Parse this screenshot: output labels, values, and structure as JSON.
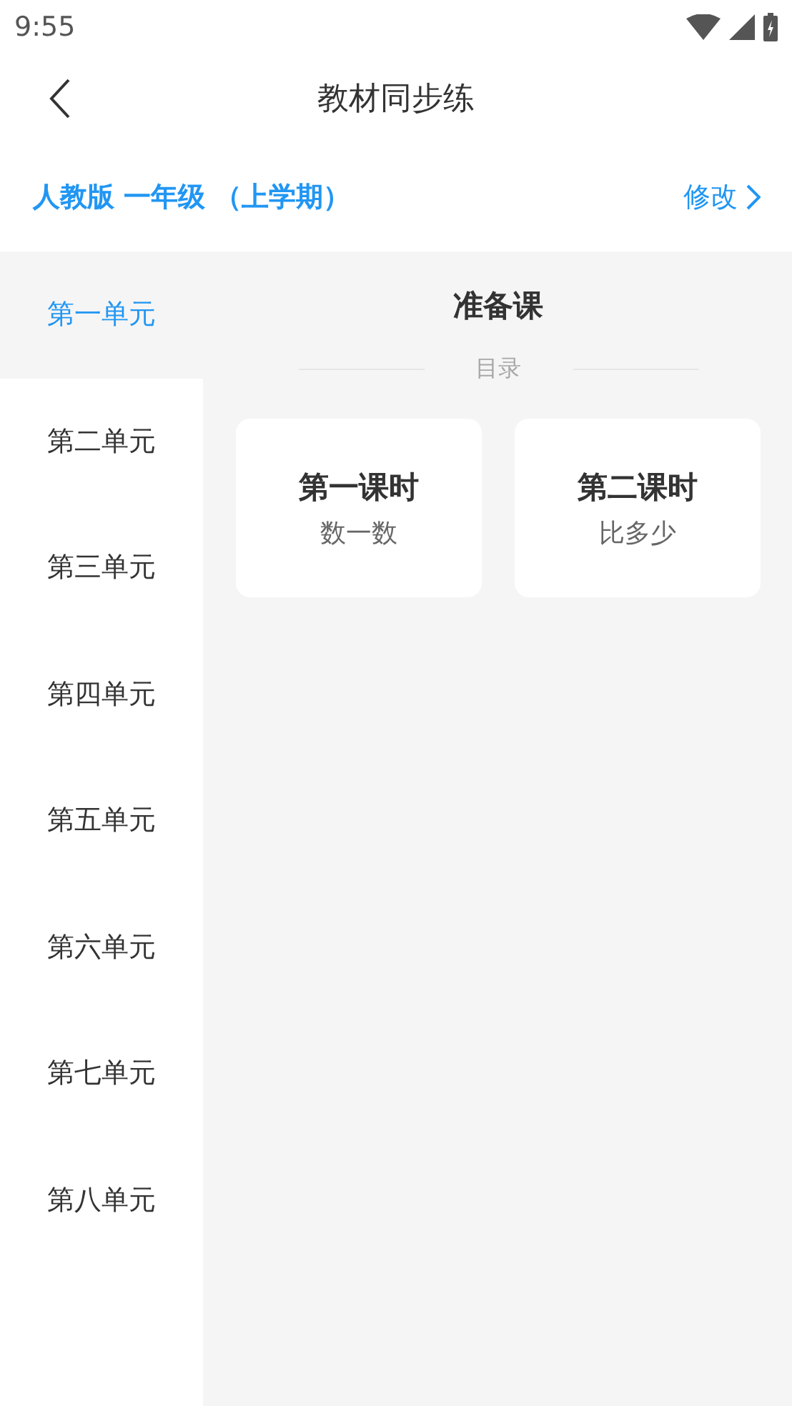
{
  "status_bar": {
    "time": "9:55"
  },
  "header": {
    "title": "教材同步练"
  },
  "textbook": {
    "name": "人教版 一年级 （上学期）",
    "change": "修改"
  },
  "units": [
    {
      "label": "第一单元",
      "selected": true
    },
    {
      "label": "第二单元",
      "selected": false
    },
    {
      "label": "第三单元",
      "selected": false
    },
    {
      "label": "第四单元",
      "selected": false
    },
    {
      "label": "第五单元",
      "selected": false
    },
    {
      "label": "第六单元",
      "selected": false
    },
    {
      "label": "第七单元",
      "selected": false
    },
    {
      "label": "第八单元",
      "selected": false
    }
  ],
  "section": {
    "title": "准备课",
    "divider": "目录",
    "lessons": [
      {
        "title": "第一课时",
        "subtitle": "数一数"
      },
      {
        "title": "第二课时",
        "subtitle": "比多少"
      }
    ]
  }
}
